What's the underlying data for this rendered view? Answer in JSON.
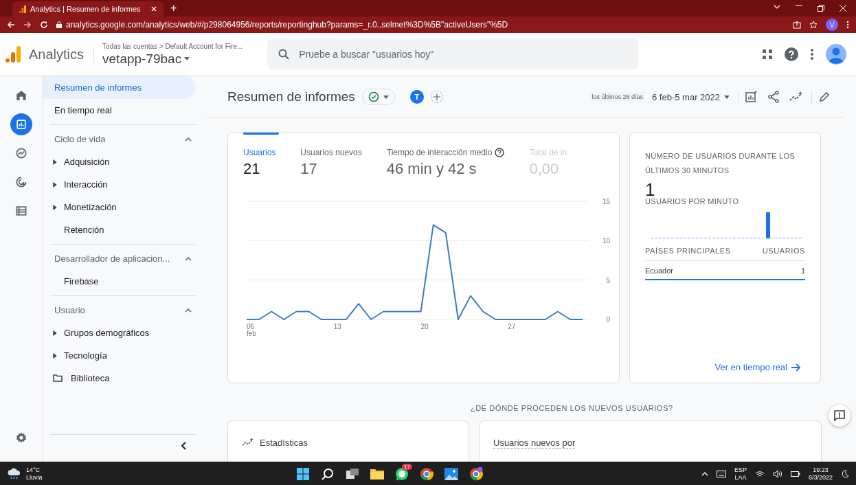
{
  "browser": {
    "tab_title": "Analytics | Resumen de informes",
    "new_tab": "+",
    "url": "analytics.google.com/analytics/web/#/p298064956/reports/reportinghub?params=_r.0..selmet%3D%5B\"activeUsers\"%5D",
    "profile": "V"
  },
  "header": {
    "product": "Analytics",
    "breadcrumb": "Todas las cuentas > Default Account for Fire...",
    "property": "vetapp-79bac",
    "search": {
      "placeholder": "Pruebe a buscar \"usuarios hoy\""
    }
  },
  "rail": [
    {
      "kind": "home",
      "selected": false
    },
    {
      "kind": "reports",
      "selected": true
    },
    {
      "kind": "explore",
      "selected": false
    },
    {
      "kind": "advertising",
      "selected": false
    },
    {
      "kind": "configure",
      "selected": false
    }
  ],
  "sidebar": {
    "items": [
      {
        "label": "Resumen de informes",
        "selected": true
      },
      {
        "label": "En tiempo real",
        "selected": false
      }
    ],
    "sections": [
      {
        "title": "Ciclo de vida",
        "expanded": true,
        "items": [
          {
            "label": "Adquisición",
            "kind": "expandable"
          },
          {
            "label": "Interacción",
            "kind": "expandable"
          },
          {
            "label": "Monetización",
            "kind": "expandable"
          },
          {
            "label": "Retención",
            "kind": "page"
          }
        ]
      },
      {
        "title": "Desarrollador de aplicacion...",
        "expanded": true,
        "items": [
          {
            "label": "Firebase",
            "kind": "page"
          }
        ]
      },
      {
        "title": "Usuario",
        "expanded": true,
        "items": [
          {
            "label": "Grupos demográficos",
            "kind": "expandable"
          },
          {
            "label": "Tecnología",
            "kind": "expandable"
          }
        ]
      }
    ],
    "library": "Biblioteca"
  },
  "page": {
    "title": "Resumen de informes",
    "comparison_avatar": "T",
    "date_hint": "los últimos 28 días",
    "date_range": "6 feb-5 mar 2022"
  },
  "metrics": [
    {
      "label": "Usuarios",
      "value": "21",
      "selected": true
    },
    {
      "label": "Usuarios nuevos",
      "value": "17",
      "selected": false
    },
    {
      "label": "Tiempo de interacción medio",
      "value": "46 min y 42 s",
      "selected": false
    },
    {
      "label": "Total de in",
      "value": "0,00",
      "selected": false
    }
  ],
  "chart_data": {
    "type": "line",
    "categories": [
      "06 feb",
      null,
      null,
      null,
      null,
      null,
      null,
      "13",
      null,
      null,
      null,
      null,
      null,
      null,
      "20",
      null,
      null,
      null,
      null,
      null,
      null,
      "27",
      null,
      null,
      null,
      null,
      null,
      null
    ],
    "ylim": [
      0,
      15
    ],
    "yticks": [
      0,
      5,
      10,
      15
    ],
    "series": [
      {
        "color": "#3b78d0",
        "values": [
          0,
          0,
          1,
          0,
          1,
          1,
          0,
          0,
          0,
          2,
          0,
          1,
          1,
          1,
          1,
          12,
          11,
          0,
          3,
          1,
          0,
          0,
          0,
          0,
          0,
          1,
          0,
          0
        ]
      }
    ]
  },
  "realtime": {
    "title": "NÚMERO DE USUARIOS DURANTE LOS ÚLTIMOS 30 MINUTOS",
    "value": "1",
    "per_minute": "USUARIOS POR MINUTO",
    "columns": [
      "PAÍSES PRINCIPALES",
      "USUARIOS"
    ],
    "rows": [
      {
        "country": "Ecuador",
        "users": "1",
        "selected": true
      }
    ],
    "link": "Ver en tiempo real"
  },
  "section_heading": "¿DE DÓNDE PROCEDEN LOS NUEVOS USUARIOS?",
  "bottom_cards": [
    "Estadísticas",
    "Usuarios nuevos por"
  ],
  "taskbar": {
    "temperature": "14°C",
    "weather": "Lluvia",
    "whatsapp_badge": "17",
    "language": "ESP",
    "layout": "LAA",
    "time": "19:23",
    "date": "6/3/2022"
  }
}
